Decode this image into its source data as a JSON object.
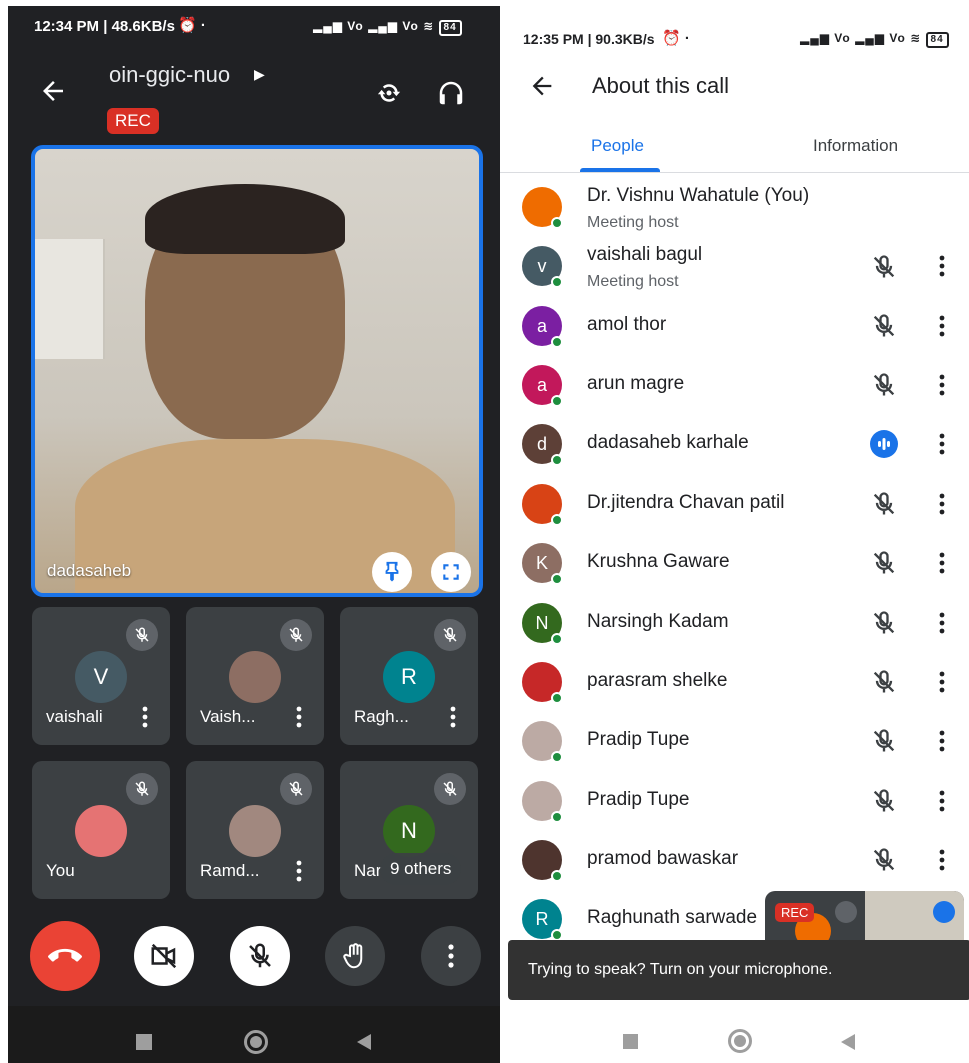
{
  "left": {
    "status": {
      "time": "12:34 PM | 48.6KB/s",
      "battery": "84"
    },
    "meeting": {
      "code": "oin-ggic-nuo",
      "rec": "REC"
    },
    "main_video": {
      "name": "dadasaheb"
    },
    "tiles": [
      {
        "name": "vaishali",
        "initial": "V",
        "color": "#455a64",
        "type": "initial"
      },
      {
        "name": "Vaish...",
        "initial": "",
        "color": "#8d6e63",
        "type": "photo"
      },
      {
        "name": "Ragh...",
        "initial": "R",
        "color": "#00838f",
        "type": "initial"
      },
      {
        "name": "You",
        "initial": "",
        "color": "#e57373",
        "type": "photo"
      },
      {
        "name": "Ramd...",
        "initial": "",
        "color": "#a1887f",
        "type": "photo"
      },
      {
        "name": "Nar",
        "initial": "N",
        "color": "#33691e",
        "type": "initial",
        "overlay": "9 others"
      }
    ]
  },
  "right": {
    "status": {
      "time": "12:35 PM | 90.3KB/s",
      "battery": "84"
    },
    "title": "About this call",
    "tabs": {
      "people": "People",
      "information": "Information"
    },
    "people": [
      {
        "name": "Dr. Vishnu Wahatule (You)",
        "sub": "Meeting host",
        "initial": "",
        "color": "#ef6c00",
        "mic": "none"
      },
      {
        "name": "vaishali bagul",
        "sub": "Meeting host",
        "initial": "v",
        "color": "#455a64",
        "mic": "muted"
      },
      {
        "name": "amol thor",
        "sub": "",
        "initial": "a",
        "color": "#7b1fa2",
        "mic": "muted"
      },
      {
        "name": "arun magre",
        "sub": "",
        "initial": "a",
        "color": "#c2185b",
        "mic": "muted"
      },
      {
        "name": "dadasaheb karhale",
        "sub": "",
        "initial": "d",
        "color": "#5d4037",
        "mic": "speaking"
      },
      {
        "name": "Dr.jitendra Chavan patil",
        "sub": "",
        "initial": "",
        "color": "#d84315",
        "mic": "muted"
      },
      {
        "name": "Krushna Gaware",
        "sub": "",
        "initial": "K",
        "color": "#8d6e63",
        "mic": "muted"
      },
      {
        "name": "Narsingh Kadam",
        "sub": "",
        "initial": "N",
        "color": "#33691e",
        "mic": "muted"
      },
      {
        "name": "parasram shelke",
        "sub": "",
        "initial": "",
        "color": "#c62828",
        "mic": "muted"
      },
      {
        "name": "Pradip Tupe",
        "sub": "",
        "initial": "",
        "color": "#bcaaa4",
        "mic": "muted"
      },
      {
        "name": "Pradip Tupe",
        "sub": "",
        "initial": "",
        "color": "#bcaaa4",
        "mic": "muted"
      },
      {
        "name": "pramod bawaskar",
        "sub": "",
        "initial": "",
        "color": "#4e342e",
        "mic": "muted"
      },
      {
        "name": "Raghunath sarwade",
        "sub": "",
        "initial": "R",
        "color": "#00838f",
        "mic": "none"
      }
    ],
    "pip": {
      "rec": "REC"
    },
    "snackbar": "Trying to speak? Turn on your microphone."
  }
}
